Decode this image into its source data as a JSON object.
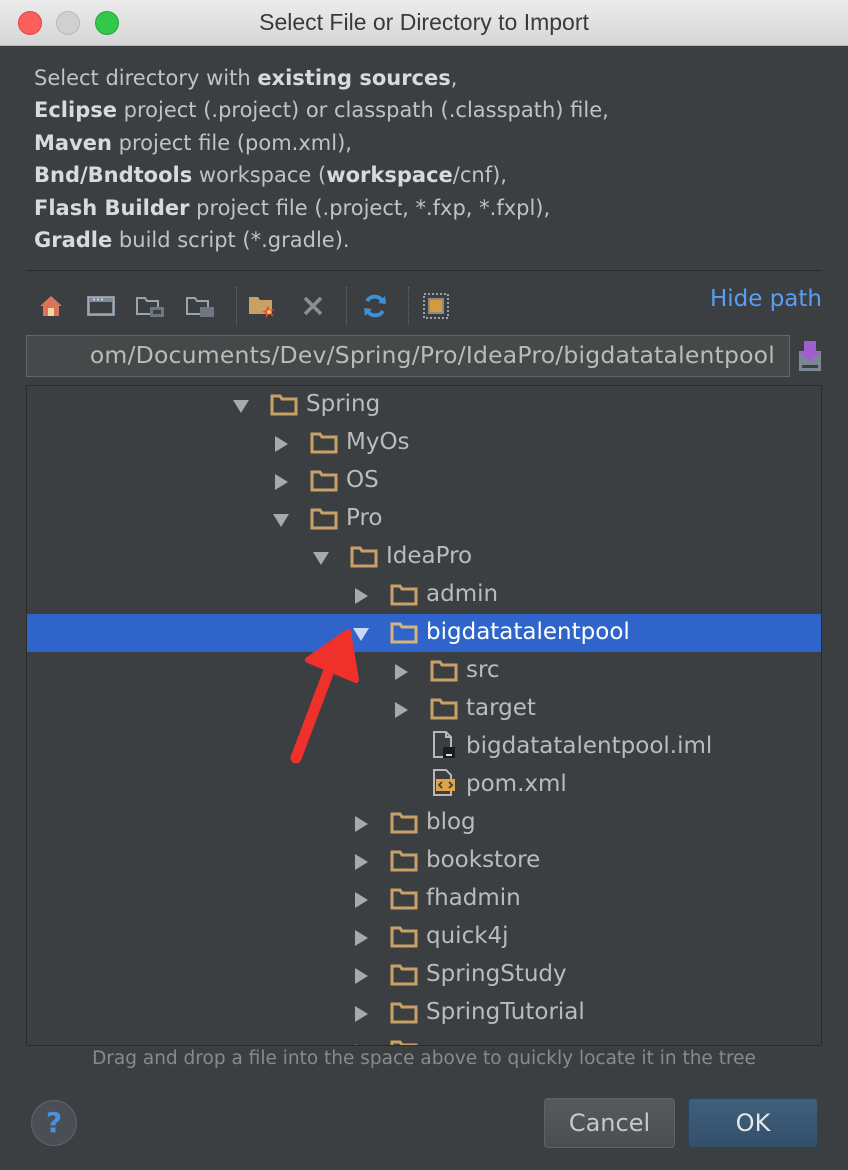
{
  "window": {
    "title": "Select File or Directory to Import"
  },
  "description": [
    [
      {
        "t": "Select directory with ",
        "b": false
      },
      {
        "t": "existing sources",
        "b": true
      },
      {
        "t": ",",
        "b": false
      }
    ],
    [
      {
        "t": "Eclipse",
        "b": true
      },
      {
        "t": " project (.project) or classpath (.classpath) file,",
        "b": false
      }
    ],
    [
      {
        "t": "Maven",
        "b": true
      },
      {
        "t": " project file (pom.xml),",
        "b": false
      }
    ],
    [
      {
        "t": "Bnd/Bndtools",
        "b": true
      },
      {
        "t": " workspace (",
        "b": false
      },
      {
        "t": "workspace",
        "b": true
      },
      {
        "t": "/cnf),",
        "b": false
      }
    ],
    [
      {
        "t": "Flash Builder",
        "b": true
      },
      {
        "t": " project file (.project, *.fxp, *.fxpl),",
        "b": false
      }
    ],
    [
      {
        "t": "Gradle",
        "b": true
      },
      {
        "t": " build script (*.gradle).",
        "b": false
      }
    ]
  ],
  "toolbar": {
    "icons": [
      "home-icon",
      "desktop-icon",
      "project-folder-icon",
      "module-folder-icon",
      "new-folder-icon",
      "delete-icon",
      "refresh-icon",
      "show-hidden-icon"
    ],
    "hide_path_label": "Hide path"
  },
  "path": {
    "value": "/Users/xxx/Documents/Dev/Spring/Pro/IdeaPro/bigdatatalentpool",
    "display": "om/Documents/Dev/Spring/Pro/IdeaPro/bigdatatalentpool"
  },
  "tree": [
    {
      "label": "Spring",
      "depth": 0,
      "type": "folder",
      "state": "expanded"
    },
    {
      "label": "MyOs",
      "depth": 1,
      "type": "folder",
      "state": "collapsed"
    },
    {
      "label": "OS",
      "depth": 1,
      "type": "folder",
      "state": "collapsed"
    },
    {
      "label": "Pro",
      "depth": 1,
      "type": "folder",
      "state": "expanded"
    },
    {
      "label": "IdeaPro",
      "depth": 2,
      "type": "folder",
      "state": "expanded"
    },
    {
      "label": "admin",
      "depth": 3,
      "type": "folder",
      "state": "collapsed"
    },
    {
      "label": "bigdatatalentpool",
      "depth": 3,
      "type": "folder",
      "state": "expanded",
      "selected": true
    },
    {
      "label": "src",
      "depth": 4,
      "type": "folder",
      "state": "collapsed"
    },
    {
      "label": "target",
      "depth": 4,
      "type": "folder",
      "state": "collapsed"
    },
    {
      "label": "bigdatatalentpool.iml",
      "depth": 4,
      "type": "iml-file",
      "state": "leaf"
    },
    {
      "label": "pom.xml",
      "depth": 4,
      "type": "xml-file",
      "state": "leaf"
    },
    {
      "label": "blog",
      "depth": 3,
      "type": "folder",
      "state": "collapsed"
    },
    {
      "label": "bookstore",
      "depth": 3,
      "type": "folder",
      "state": "collapsed"
    },
    {
      "label": "fhadmin",
      "depth": 3,
      "type": "folder",
      "state": "collapsed"
    },
    {
      "label": "quick4j",
      "depth": 3,
      "type": "folder",
      "state": "collapsed"
    },
    {
      "label": "SpringStudy",
      "depth": 3,
      "type": "folder",
      "state": "collapsed"
    },
    {
      "label": "SpringTutorial",
      "depth": 3,
      "type": "folder",
      "state": "collapsed"
    },
    {
      "label": "",
      "depth": 3,
      "type": "folder",
      "state": "collapsed"
    }
  ],
  "hint": "Drag and drop a file into the space above to quickly locate it in the tree",
  "buttons": {
    "help": "?",
    "cancel": "Cancel",
    "ok": "OK"
  },
  "colors": {
    "selection": "#2f65ca",
    "folder": "#c9a166",
    "link": "#589df6",
    "annotation_arrow": "#f0302a"
  }
}
